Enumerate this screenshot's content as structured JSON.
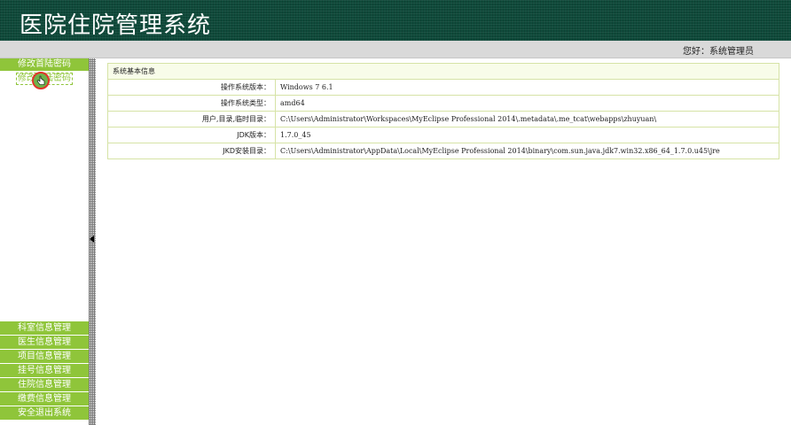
{
  "header": {
    "title": "医院住院管理系统"
  },
  "userbar": {
    "greeting": "您好：系统管理员"
  },
  "sidebar": {
    "top_items": [
      {
        "label": "修改首陆密码"
      },
      {
        "label": "修改首陆密码"
      }
    ],
    "bottom_items": [
      {
        "label": "科室信息管理"
      },
      {
        "label": "医生信息管理"
      },
      {
        "label": "项目信息管理"
      },
      {
        "label": "挂号信息管理"
      },
      {
        "label": "住院信息管理"
      },
      {
        "label": "缴费信息管理"
      },
      {
        "label": "安全退出系统"
      }
    ]
  },
  "system_info": {
    "caption": "系统基本信息",
    "rows": [
      {
        "label": "操作系统版本：",
        "value": "Windows 7  6.1"
      },
      {
        "label": "操作系统类型：",
        "value": "amd64"
      },
      {
        "label": "用户,目录,临时目录：",
        "value": "C:\\Users\\Administrator\\Workspaces\\MyEclipse Professional 2014\\.metadata\\.me_tcat\\webapps\\zhuyuan\\"
      },
      {
        "label": "JDK版本：",
        "value": "1.7.0_45"
      },
      {
        "label": "JKD安装目录：",
        "value": "C:\\Users\\Administrator\\AppData\\Local\\MyEclipse Professional 2014\\binary\\com.sun.java.jdk7.win32.x86_64_1.7.0.u45\\jre"
      }
    ]
  },
  "colors": {
    "header_bg": "#0f4a3a",
    "menu_green": "#8fc53a",
    "table_border": "#d6e3a6"
  },
  "icons": {
    "cursor": "hand-pointer-icon",
    "splitter_arrow": "collapse-left-arrow-icon"
  }
}
